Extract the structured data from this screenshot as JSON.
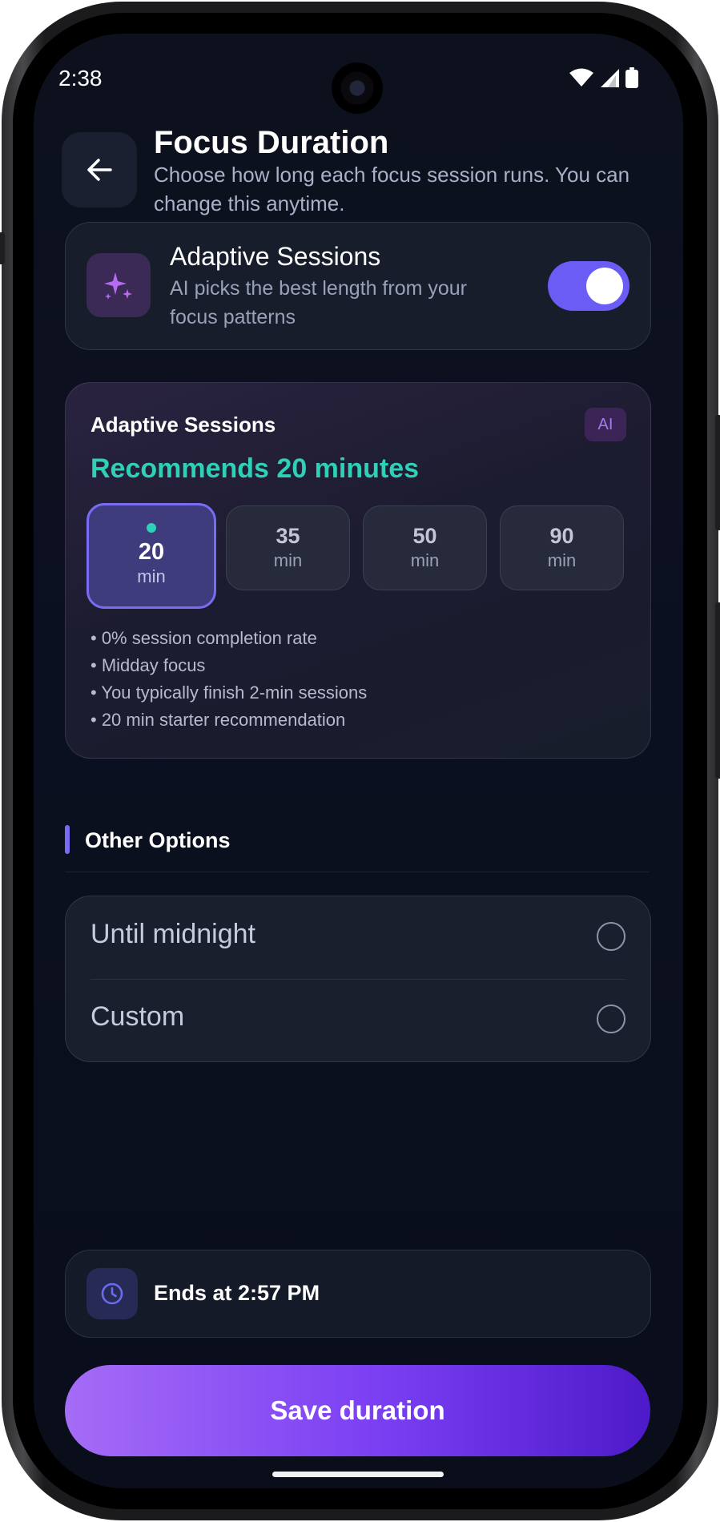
{
  "status_bar": {
    "time": "2:38"
  },
  "header": {
    "title": "Focus Duration",
    "subtitle": "Choose how long each focus session runs. You can change this anytime."
  },
  "adaptive_toggle": {
    "title": "Adaptive Sessions",
    "description": "AI picks the best length from your focus patterns",
    "enabled": true
  },
  "recommendation": {
    "label": "Adaptive Sessions",
    "badge": "AI",
    "headline": "Recommends 20 minutes",
    "options": [
      {
        "value": "20",
        "unit": "min",
        "selected": true
      },
      {
        "value": "35",
        "unit": "min",
        "selected": false
      },
      {
        "value": "50",
        "unit": "min",
        "selected": false
      },
      {
        "value": "90",
        "unit": "min",
        "selected": false
      }
    ],
    "reasons": [
      "• 0% session completion rate",
      "• Midday focus",
      "• You typically finish 2-min sessions",
      "• 20 min starter recommendation"
    ]
  },
  "other_options": {
    "title": "Other Options",
    "items": [
      {
        "label": "Until midnight",
        "selected": false
      },
      {
        "label": "Custom",
        "selected": false
      }
    ]
  },
  "end_time": {
    "text": "Ends at 2:57 PM"
  },
  "save_button": {
    "label": "Save duration"
  },
  "colors": {
    "accent": "#7a6cf2",
    "teal": "#2ed1b6",
    "background": "#0b1020"
  },
  "icons": [
    "back-arrow-icon",
    "sparkle-icon",
    "clock-icon",
    "wifi-icon",
    "signal-icon",
    "battery-icon"
  ]
}
